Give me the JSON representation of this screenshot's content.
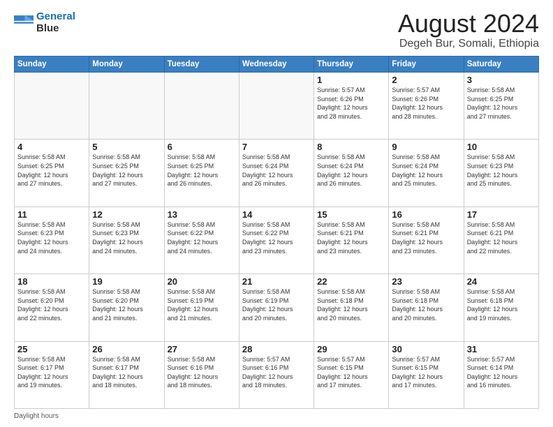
{
  "logo": {
    "line1": "General",
    "line2": "Blue"
  },
  "header": {
    "month_year": "August 2024",
    "location": "Degeh Bur, Somali, Ethiopia"
  },
  "weekdays": [
    "Sunday",
    "Monday",
    "Tuesday",
    "Wednesday",
    "Thursday",
    "Friday",
    "Saturday"
  ],
  "footer": {
    "label": "Daylight hours"
  },
  "weeks": [
    [
      {
        "day": "",
        "info": ""
      },
      {
        "day": "",
        "info": ""
      },
      {
        "day": "",
        "info": ""
      },
      {
        "day": "",
        "info": ""
      },
      {
        "day": "1",
        "info": "Sunrise: 5:57 AM\nSunset: 6:26 PM\nDaylight: 12 hours\nand 28 minutes."
      },
      {
        "day": "2",
        "info": "Sunrise: 5:57 AM\nSunset: 6:26 PM\nDaylight: 12 hours\nand 28 minutes."
      },
      {
        "day": "3",
        "info": "Sunrise: 5:58 AM\nSunset: 6:25 PM\nDaylight: 12 hours\nand 27 minutes."
      }
    ],
    [
      {
        "day": "4",
        "info": "Sunrise: 5:58 AM\nSunset: 6:25 PM\nDaylight: 12 hours\nand 27 minutes."
      },
      {
        "day": "5",
        "info": "Sunrise: 5:58 AM\nSunset: 6:25 PM\nDaylight: 12 hours\nand 27 minutes."
      },
      {
        "day": "6",
        "info": "Sunrise: 5:58 AM\nSunset: 6:25 PM\nDaylight: 12 hours\nand 26 minutes."
      },
      {
        "day": "7",
        "info": "Sunrise: 5:58 AM\nSunset: 6:24 PM\nDaylight: 12 hours\nand 26 minutes."
      },
      {
        "day": "8",
        "info": "Sunrise: 5:58 AM\nSunset: 6:24 PM\nDaylight: 12 hours\nand 26 minutes."
      },
      {
        "day": "9",
        "info": "Sunrise: 5:58 AM\nSunset: 6:24 PM\nDaylight: 12 hours\nand 25 minutes."
      },
      {
        "day": "10",
        "info": "Sunrise: 5:58 AM\nSunset: 6:23 PM\nDaylight: 12 hours\nand 25 minutes."
      }
    ],
    [
      {
        "day": "11",
        "info": "Sunrise: 5:58 AM\nSunset: 6:23 PM\nDaylight: 12 hours\nand 24 minutes."
      },
      {
        "day": "12",
        "info": "Sunrise: 5:58 AM\nSunset: 6:23 PM\nDaylight: 12 hours\nand 24 minutes."
      },
      {
        "day": "13",
        "info": "Sunrise: 5:58 AM\nSunset: 6:22 PM\nDaylight: 12 hours\nand 24 minutes."
      },
      {
        "day": "14",
        "info": "Sunrise: 5:58 AM\nSunset: 6:22 PM\nDaylight: 12 hours\nand 23 minutes."
      },
      {
        "day": "15",
        "info": "Sunrise: 5:58 AM\nSunset: 6:21 PM\nDaylight: 12 hours\nand 23 minutes."
      },
      {
        "day": "16",
        "info": "Sunrise: 5:58 AM\nSunset: 6:21 PM\nDaylight: 12 hours\nand 23 minutes."
      },
      {
        "day": "17",
        "info": "Sunrise: 5:58 AM\nSunset: 6:21 PM\nDaylight: 12 hours\nand 22 minutes."
      }
    ],
    [
      {
        "day": "18",
        "info": "Sunrise: 5:58 AM\nSunset: 6:20 PM\nDaylight: 12 hours\nand 22 minutes."
      },
      {
        "day": "19",
        "info": "Sunrise: 5:58 AM\nSunset: 6:20 PM\nDaylight: 12 hours\nand 21 minutes."
      },
      {
        "day": "20",
        "info": "Sunrise: 5:58 AM\nSunset: 6:19 PM\nDaylight: 12 hours\nand 21 minutes."
      },
      {
        "day": "21",
        "info": "Sunrise: 5:58 AM\nSunset: 6:19 PM\nDaylight: 12 hours\nand 20 minutes."
      },
      {
        "day": "22",
        "info": "Sunrise: 5:58 AM\nSunset: 6:18 PM\nDaylight: 12 hours\nand 20 minutes."
      },
      {
        "day": "23",
        "info": "Sunrise: 5:58 AM\nSunset: 6:18 PM\nDaylight: 12 hours\nand 20 minutes."
      },
      {
        "day": "24",
        "info": "Sunrise: 5:58 AM\nSunset: 6:18 PM\nDaylight: 12 hours\nand 19 minutes."
      }
    ],
    [
      {
        "day": "25",
        "info": "Sunrise: 5:58 AM\nSunset: 6:17 PM\nDaylight: 12 hours\nand 19 minutes."
      },
      {
        "day": "26",
        "info": "Sunrise: 5:58 AM\nSunset: 6:17 PM\nDaylight: 12 hours\nand 18 minutes."
      },
      {
        "day": "27",
        "info": "Sunrise: 5:58 AM\nSunset: 6:16 PM\nDaylight: 12 hours\nand 18 minutes."
      },
      {
        "day": "28",
        "info": "Sunrise: 5:57 AM\nSunset: 6:16 PM\nDaylight: 12 hours\nand 18 minutes."
      },
      {
        "day": "29",
        "info": "Sunrise: 5:57 AM\nSunset: 6:15 PM\nDaylight: 12 hours\nand 17 minutes."
      },
      {
        "day": "30",
        "info": "Sunrise: 5:57 AM\nSunset: 6:15 PM\nDaylight: 12 hours\nand 17 minutes."
      },
      {
        "day": "31",
        "info": "Sunrise: 5:57 AM\nSunset: 6:14 PM\nDaylight: 12 hours\nand 16 minutes."
      }
    ]
  ]
}
